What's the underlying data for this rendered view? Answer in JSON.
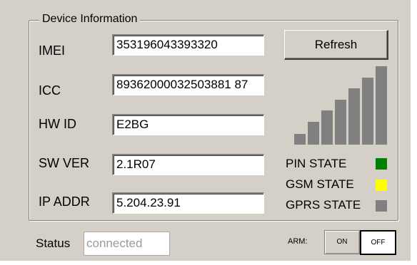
{
  "group": {
    "title": "Device Information"
  },
  "fields": {
    "imei": {
      "label": "IMEI",
      "value": "353196043393320"
    },
    "icc": {
      "label": "ICC",
      "value": "89362000032503881 87"
    },
    "hw_id": {
      "label": "HW ID",
      "value": "E2BG"
    },
    "sw_ver": {
      "label": "SW VER",
      "value": "2.1R07"
    },
    "ip_addr": {
      "label": "IP ADDR",
      "value": "5.204.23.91"
    }
  },
  "refresh_button": {
    "label": "Refresh"
  },
  "signal": {
    "bars_total": 7,
    "bars_lit": 7,
    "color": "#808080"
  },
  "states": [
    {
      "label": "PIN STATE",
      "color": "#008000"
    },
    {
      "label": "GSM STATE",
      "color": "#ffff00"
    },
    {
      "label": "GPRS STATE",
      "color": "#808080"
    }
  ],
  "status": {
    "label": "Status",
    "value": "connected"
  },
  "arm": {
    "label": "ARM:",
    "on_label": "ON",
    "off_label": "OFF",
    "selected": "OFF"
  }
}
